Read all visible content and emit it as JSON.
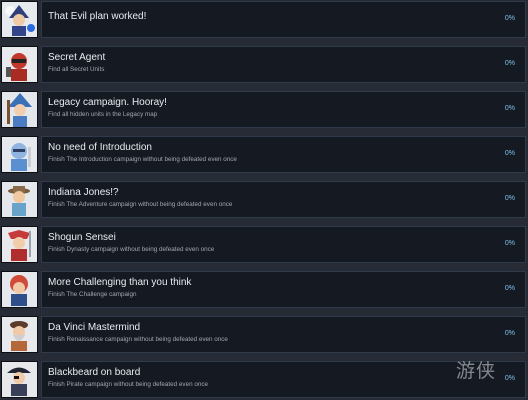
{
  "achievements": [
    {
      "title": "That Evil plan worked!",
      "description": "",
      "progress": "0%",
      "icon": "dark-wizard-character-icon",
      "accent": "#3c5aa8"
    },
    {
      "title": "Secret Agent",
      "description": "Find all Secret Units",
      "progress": "0%",
      "icon": "red-ninja-agent-icon",
      "accent": "#c0392b"
    },
    {
      "title": "Legacy campaign. Hooray!",
      "description": "Find all hidden units in the Legacy map",
      "progress": "0%",
      "icon": "blue-wizard-hat-icon",
      "accent": "#3b6fb6"
    },
    {
      "title": "No need of Introduction",
      "description": "Finish The Introduction campaign without being defeated even once",
      "progress": "0%",
      "icon": "blue-knight-icon",
      "accent": "#5a8fd0"
    },
    {
      "title": "Indiana Jones!?",
      "description": "Finish The Adventure campaign without being defeated even once",
      "progress": "0%",
      "icon": "explorer-character-icon",
      "accent": "#6aa3c9"
    },
    {
      "title": "Shogun Sensei",
      "description": "Finish Dynasty campaign without being defeated even once",
      "progress": "0%",
      "icon": "red-samurai-icon",
      "accent": "#c63a3a"
    },
    {
      "title": "More Challenging than you think",
      "description": "Finish The Challenge campaign",
      "progress": "0%",
      "icon": "red-haired-hero-icon",
      "accent": "#d04a3a"
    },
    {
      "title": "Da Vinci Mastermind",
      "description": "Finish Renaissance campaign without being defeated even once",
      "progress": "0%",
      "icon": "renaissance-inventor-icon",
      "accent": "#b5673a"
    },
    {
      "title": "Blackbeard on board",
      "description": "Finish Pirate campaign without being defeated even once",
      "progress": "0%",
      "icon": "pirate-captain-icon",
      "accent": "#3a3f58"
    }
  ],
  "watermark": "游侠"
}
